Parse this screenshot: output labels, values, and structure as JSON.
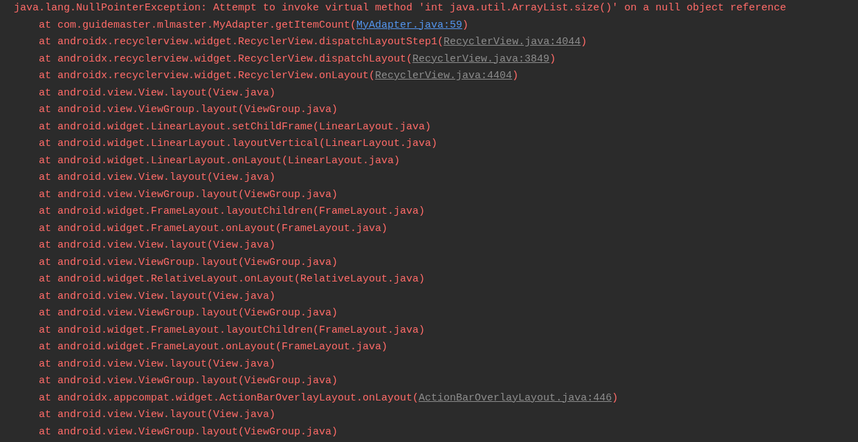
{
  "console": {
    "exception": "java.lang.NullPointerException: Attempt to invoke virtual method 'int java.util.ArrayList.size()' on a null object reference",
    "frames": [
      {
        "text": "at com.guidemaster.mlmaster.MyAdapter.getItemCount(",
        "link": {
          "text": "MyAdapter.java:59",
          "kind": "source"
        },
        "tail": ")"
      },
      {
        "text": "at androidx.recyclerview.widget.RecyclerView.dispatchLayoutStep1(",
        "link": {
          "text": "RecyclerView.java:4044",
          "kind": "library"
        },
        "tail": ")"
      },
      {
        "text": "at androidx.recyclerview.widget.RecyclerView.dispatchLayout(",
        "link": {
          "text": "RecyclerView.java:3849",
          "kind": "library"
        },
        "tail": ")"
      },
      {
        "text": "at androidx.recyclerview.widget.RecyclerView.onLayout(",
        "link": {
          "text": "RecyclerView.java:4404",
          "kind": "library"
        },
        "tail": ")"
      },
      {
        "text": "at android.view.View.layout(View.java)"
      },
      {
        "text": "at android.view.ViewGroup.layout(ViewGroup.java)"
      },
      {
        "text": "at android.widget.LinearLayout.setChildFrame(LinearLayout.java)"
      },
      {
        "text": "at android.widget.LinearLayout.layoutVertical(LinearLayout.java)"
      },
      {
        "text": "at android.widget.LinearLayout.onLayout(LinearLayout.java)"
      },
      {
        "text": "at android.view.View.layout(View.java)"
      },
      {
        "text": "at android.view.ViewGroup.layout(ViewGroup.java)"
      },
      {
        "text": "at android.widget.FrameLayout.layoutChildren(FrameLayout.java)"
      },
      {
        "text": "at android.widget.FrameLayout.onLayout(FrameLayout.java)"
      },
      {
        "text": "at android.view.View.layout(View.java)"
      },
      {
        "text": "at android.view.ViewGroup.layout(ViewGroup.java)"
      },
      {
        "text": "at android.widget.RelativeLayout.onLayout(RelativeLayout.java)"
      },
      {
        "text": "at android.view.View.layout(View.java)"
      },
      {
        "text": "at android.view.ViewGroup.layout(ViewGroup.java)"
      },
      {
        "text": "at android.widget.FrameLayout.layoutChildren(FrameLayout.java)"
      },
      {
        "text": "at android.widget.FrameLayout.onLayout(FrameLayout.java)"
      },
      {
        "text": "at android.view.View.layout(View.java)"
      },
      {
        "text": "at android.view.ViewGroup.layout(ViewGroup.java)"
      },
      {
        "text": "at androidx.appcompat.widget.ActionBarOverlayLayout.onLayout(",
        "link": {
          "text": "ActionBarOverlayLayout.java:446",
          "kind": "library"
        },
        "tail": ")"
      },
      {
        "text": "at android.view.View.layout(View.java)"
      },
      {
        "text": "at android.view.ViewGroup.layout(ViewGroup.java)"
      }
    ]
  }
}
